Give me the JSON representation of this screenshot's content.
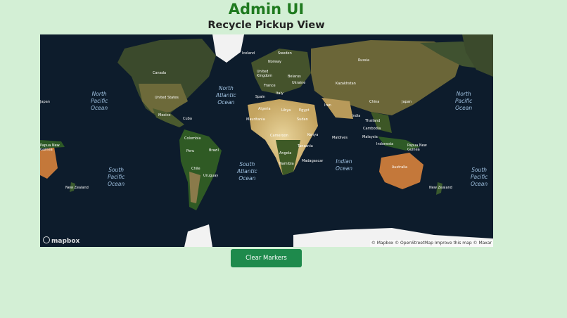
{
  "header": {
    "title": "Admin UI",
    "subtitle": "Recycle Pickup View"
  },
  "map": {
    "logo": "mapbox",
    "attribution": "© Mapbox © OpenStreetMap Improve this map © Maxar",
    "ocean_labels": {
      "north_pacific_l": [
        "North",
        "Pacific",
        "Ocean"
      ],
      "north_pacific_r": [
        "North",
        "Pacific",
        "Ocean"
      ],
      "north_atlantic": [
        "North",
        "Atlantic",
        "Ocean"
      ],
      "south_pacific_l": [
        "South",
        "Pacific",
        "Ocean"
      ],
      "south_pacific_r": [
        "South",
        "Pacific",
        "Ocean"
      ],
      "south_atlantic": [
        "South",
        "Atlantic",
        "Ocean"
      ],
      "indian": [
        "Indian",
        "Ocean"
      ]
    },
    "country_labels": {
      "canada": "Canada",
      "united_states": "United States",
      "mexico": "Mexico",
      "cuba": "Cuba",
      "colombia": "Colombia",
      "peru": "Peru",
      "brazil": "Brazil",
      "chile": "Chile",
      "uruguay": "Uruguay",
      "iceland": "Iceland",
      "sweden": "Sweden",
      "norway": "Norway",
      "united_kingdom": "United Kingdom",
      "belarus": "Belarus",
      "ukraine": "Ukraine",
      "france": "France",
      "spain": "Spain",
      "italy": "Italy",
      "algeria": "Algeria",
      "libya": "Libya",
      "egypt": "Egypt",
      "mauritania": "Mauritania",
      "sudan": "Sudan",
      "cameroon": "Cameroon",
      "kenya": "Kenya",
      "angola": "Angola",
      "tanzania": "Tanzania",
      "namibia": "Namibia",
      "madagascar": "Madagascar",
      "russia": "Russia",
      "kazakhstan": "Kazakhstan",
      "iran": "Iran",
      "china": "China",
      "india": "India",
      "japan_l": "Japan",
      "japan_r": "Japan",
      "thailand": "Thailand",
      "cambodia": "Cambodia",
      "malaysia": "Malaysia",
      "indonesia": "Indonesia",
      "maldives": "Maldives",
      "png_l": "Papua New Guinea",
      "png_r": "Papua New Guinea",
      "australia": "Australia",
      "nz_l": "New Zealand",
      "nz_r": "New Zealand"
    }
  },
  "actions": {
    "clear_markers": "Clear Markers"
  },
  "colors": {
    "background": "#d3efd5",
    "title": "#1f7a1f",
    "button": "#1e8a4c"
  }
}
